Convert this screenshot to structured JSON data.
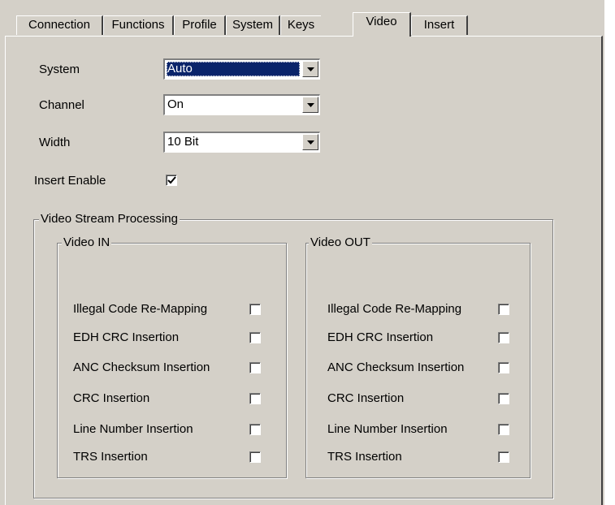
{
  "tabs": [
    "Connection",
    "Functions",
    "Profile",
    "System",
    "Keys",
    "Video",
    "Insert"
  ],
  "active_tab": "Video",
  "fields": {
    "system": {
      "label": "System",
      "value": "Auto"
    },
    "channel": {
      "label": "Channel",
      "value": "On"
    },
    "width": {
      "label": "Width",
      "value": "10 Bit"
    },
    "insert_enable": {
      "label": "Insert Enable",
      "checked": true
    }
  },
  "processing": {
    "title": "Video Stream Processing",
    "video_in": {
      "title": "Video IN",
      "options": [
        {
          "label": "Illegal Code Re-Mapping",
          "checked": false
        },
        {
          "label": "EDH CRC Insertion",
          "checked": false
        },
        {
          "label": "ANC Checksum Insertion",
          "checked": false
        },
        {
          "label": "CRC Insertion",
          "checked": false
        },
        {
          "label": "Line Number Insertion",
          "checked": false
        },
        {
          "label": "TRS Insertion",
          "checked": false
        }
      ]
    },
    "video_out": {
      "title": "Video OUT",
      "options": [
        {
          "label": "Illegal Code Re-Mapping",
          "checked": false
        },
        {
          "label": "EDH CRC Insertion",
          "checked": false
        },
        {
          "label": "ANC Checksum Insertion",
          "checked": false
        },
        {
          "label": "CRC Insertion",
          "checked": false
        },
        {
          "label": "Line Number Insertion",
          "checked": false
        },
        {
          "label": "TRS Insertion",
          "checked": false
        }
      ]
    }
  }
}
